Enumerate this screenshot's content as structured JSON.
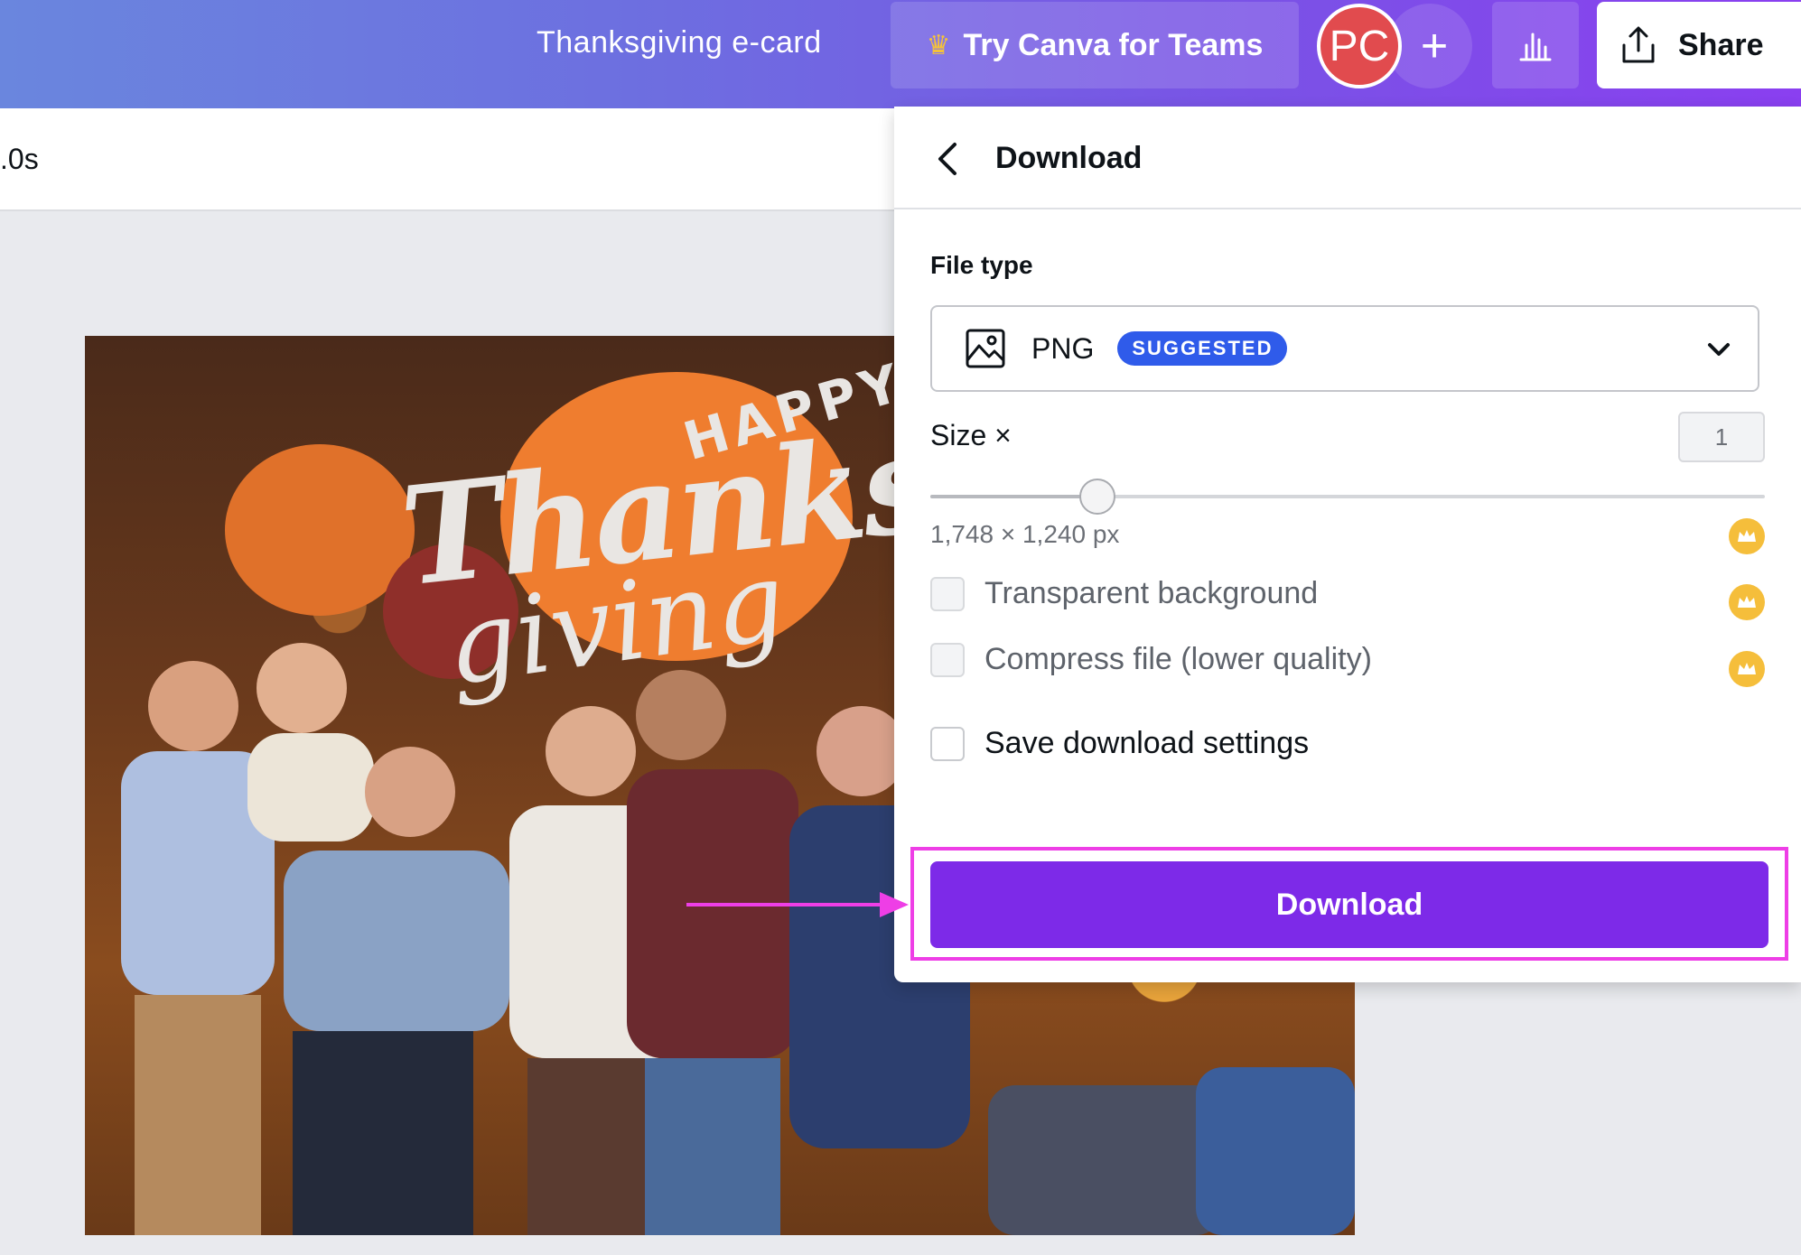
{
  "topbar": {
    "doc_title": "Thanksgiving e-card",
    "teams_label": "Try Canva for Teams",
    "avatar_initials": "PC",
    "add_label": "+",
    "share_label": "Share"
  },
  "editor": {
    "timing_label": ".0s"
  },
  "canvas": {
    "happy": "HAPPY",
    "thanks": "Thanks",
    "giving": "giving"
  },
  "download_panel": {
    "title": "Download",
    "file_type_label": "File type",
    "file_type_value": "PNG",
    "suggested_badge": "SUGGESTED",
    "size_label": "Size ×",
    "size_value": "1",
    "size_slider_fraction": 0.2,
    "dimensions": "1,748 × 1,240 px",
    "options": [
      {
        "label": "Transparent background",
        "checked": false,
        "pro": true
      },
      {
        "label": "Compress file (lower quality)",
        "checked": false,
        "pro": true
      },
      {
        "label": "Save download settings",
        "checked": false,
        "pro": false
      }
    ],
    "download_button": "Download"
  },
  "colors": {
    "accent": "#7d2ae8",
    "badge": "#2f5bea",
    "highlight": "#ee3ee6",
    "pro_crown": "#f5be3b",
    "avatar": "#e14b4e"
  }
}
